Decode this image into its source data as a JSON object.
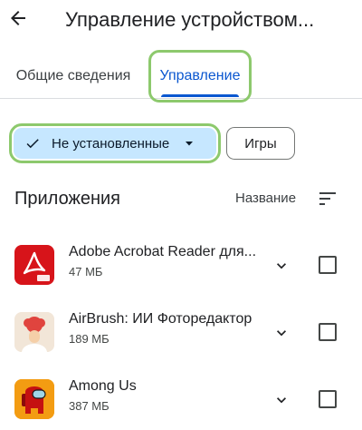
{
  "header": {
    "title": "Управление устройством...",
    "back_icon": "arrow-left-icon"
  },
  "tabs": [
    {
      "label": "Общие сведения",
      "selected": false
    },
    {
      "label": "Управление",
      "selected": true
    }
  ],
  "filters": {
    "primary": {
      "label": "Не установленные",
      "selected": true,
      "icons": [
        "check-icon",
        "dropdown-arrow-icon"
      ]
    },
    "secondary": {
      "label": "Игры",
      "selected": false
    }
  },
  "apps_section": {
    "title": "Приложения",
    "sort_label": "Название",
    "sort_icon": "sort-icon"
  },
  "apps": [
    {
      "name": "Adobe Acrobat Reader для...",
      "size": "47 МБ",
      "icon": "adobe-acrobat-icon",
      "checked": false
    },
    {
      "name": "AirBrush: ИИ Фоторедактор",
      "size": "189 МБ",
      "icon": "airbrush-icon",
      "checked": false
    },
    {
      "name": "Among Us",
      "size": "387 МБ",
      "icon": "among-us-icon",
      "checked": false
    }
  ],
  "colors": {
    "accent": "#0b57d0",
    "chip_selected_bg": "#c6e7ff",
    "highlight_outline": "#8dc96d",
    "adobe_red": "#d7141a",
    "among_us_red": "#c51111"
  }
}
